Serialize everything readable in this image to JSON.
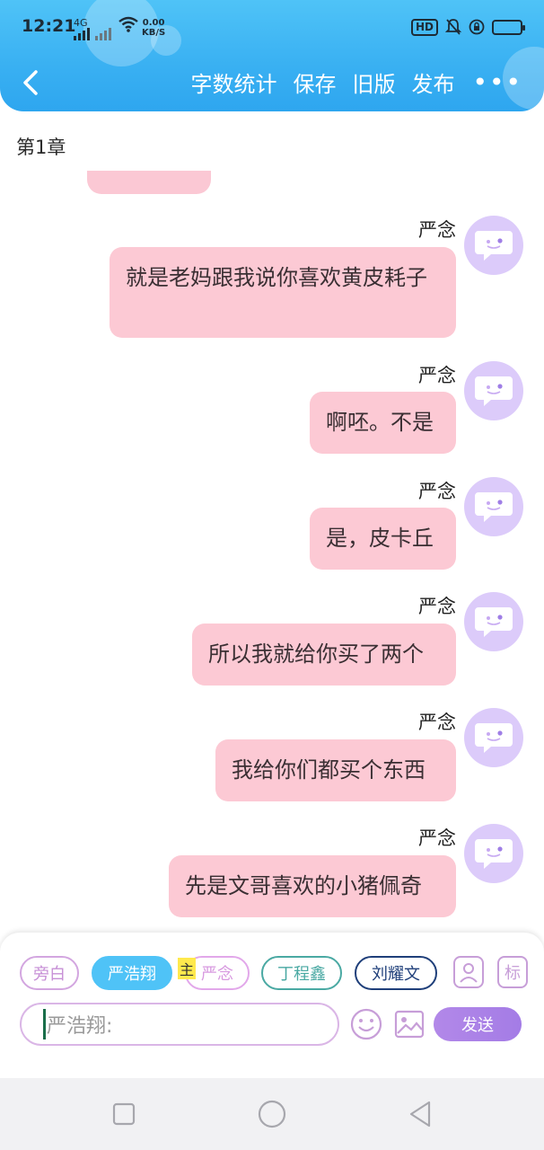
{
  "status_bar": {
    "time": "12:21",
    "network": "4G",
    "speed_value": "0.00",
    "speed_unit": "KB/S",
    "hd": "HD"
  },
  "header": {
    "toolbar": [
      "字数统计",
      "保存",
      "旧版",
      "发布"
    ],
    "more": "•••"
  },
  "chapter_title": "第1章",
  "messages": [
    {
      "sender": "严念",
      "text": "就是老妈跟我说你喜欢黄皮耗子"
    },
    {
      "sender": "严念",
      "text": "啊呸。不是"
    },
    {
      "sender": "严念",
      "text": "是，皮卡丘"
    },
    {
      "sender": "严念",
      "text": "所以我就给你买了两个"
    },
    {
      "sender": "严念",
      "text": "我给你们都买个东西"
    },
    {
      "sender": "严念",
      "text": "先是文哥喜欢的小猪佩奇"
    }
  ],
  "composer": {
    "roles": [
      {
        "label": "旁白",
        "color": "#c78fd6"
      },
      {
        "label": "严浩翔",
        "color": "#4fc3f7",
        "selected": true
      },
      {
        "label": "严念",
        "color": "#d89ae0"
      },
      {
        "label": "丁程鑫",
        "color": "#4aa9a3"
      },
      {
        "label": "刘耀文",
        "color": "#1f3f7a"
      }
    ],
    "main_badge": "主",
    "tag_button": "标",
    "input_placeholder": "严浩翔:",
    "send_label": "发送"
  },
  "colors": {
    "header": "#39b0f2",
    "bubble": "#fcc9d4",
    "avatar": "#dccbfa",
    "send": "#a47ce6"
  }
}
